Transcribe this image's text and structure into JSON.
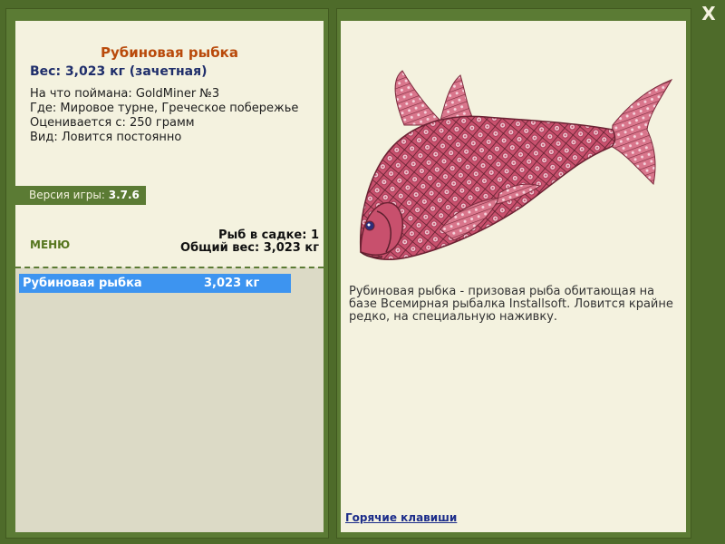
{
  "close": {
    "label": "X"
  },
  "fish": {
    "title": "Рубиновая рыбка",
    "weight": "Вес: 3,023 кг (зачетная)",
    "caught_with": "На что поймана: GoldMiner №3",
    "location": "Где: Мировое турне, Греческое побережье",
    "valued_from": "Оценивается с: 250 грамм",
    "kind": "Вид: Ловится постоянно"
  },
  "version": {
    "label": "Версия игры:",
    "value": "3.7.6"
  },
  "menu": {
    "label": "МЕНЮ"
  },
  "stats": {
    "count": "Рыб в садке: 1",
    "total": "Общий вес: 3,023 кг"
  },
  "catch_list": [
    {
      "name": "Рубиновая рыбка",
      "weight": "3,023 кг"
    }
  ],
  "description": "Рубиновая рыбка - призовая рыба обитающая на базе Всемирная рыбалка Installsoft. Ловится крайне редко, на специальную наживку.",
  "hotkeys": {
    "label": "Горячие клавиши"
  },
  "colors": {
    "frame": "#5b7b34",
    "panel": "#f4f2df",
    "title": "#b94a0b",
    "selected_row": "#3d94f0",
    "fish_body": "#c8506d"
  }
}
